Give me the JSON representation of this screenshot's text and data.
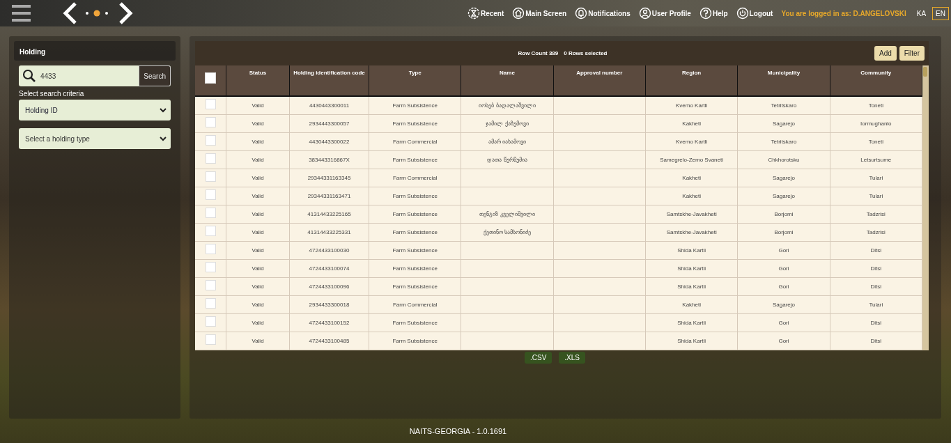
{
  "top_bar": {
    "nav": [
      {
        "kind": "recent",
        "label": "Recent"
      },
      {
        "kind": "home",
        "label": "Main Screen"
      },
      {
        "kind": "bell",
        "label": "Notifications"
      },
      {
        "kind": "user",
        "label": "User Profile"
      },
      {
        "kind": "help",
        "label": "Help"
      },
      {
        "kind": "power",
        "label": "Logout"
      }
    ],
    "login_text": "You are logged in as: D.ANGELOVSKI",
    "languages": [
      {
        "label": "KA",
        "selected": false
      },
      {
        "label": "EN",
        "selected": true
      }
    ]
  },
  "search_panel": {
    "title": "Holding",
    "search": {
      "value": "4433",
      "button": "Search"
    },
    "criteria_label": "Select search criteria",
    "criteria": "Holding ID",
    "holding_type": {
      "placeholder": "Select a holding type"
    }
  },
  "table": {
    "row_count": "Row Count 389",
    "selected_count": "0 Rows selected",
    "buttons": [
      "Add",
      "Filter"
    ],
    "header_checked": false,
    "columns": [
      "Status",
      "Holding identification code",
      "Type",
      "Name",
      "Approval number",
      "Region",
      "Municipality",
      "Community"
    ],
    "rows": [
      {
        "selected": false,
        "cells": [
          "Valid",
          "4430443300011",
          "Farm Subsistence",
          "იოსებ ბადალაშვილი",
          "",
          "Kvemo Kartli",
          "Tetritskaro",
          "Toneti"
        ]
      },
      {
        "selected": false,
        "cells": [
          "Valid",
          "2934443300057",
          "Farm Subsistence",
          "ჯამილ ქაზუმოვი",
          "",
          "Kakheti",
          "Sagarejo",
          "Iormughanlo"
        ]
      },
      {
        "selected": false,
        "cells": [
          "Valid",
          "4430443300022",
          "Farm Commercial",
          "ამარ იასამოვი",
          "",
          "Kvemo Kartli",
          "Tetritskaro",
          "Toneti"
        ]
      },
      {
        "selected": false,
        "cells": [
          "Valid",
          "383443316867X",
          "Farm Subsistence",
          "დათა წურწუმია",
          "",
          "Samegrelo-Zemo Svaneti",
          "Chkhorotsku",
          "Letsurtsume"
        ]
      },
      {
        "selected": false,
        "cells": [
          "Valid",
          "29344331163345",
          "Farm Commercial",
          "",
          "",
          "Kakheti",
          "Sagarejo",
          "Tulari"
        ]
      },
      {
        "selected": false,
        "cells": [
          "Valid",
          "29344331163471",
          "Farm Subsistence",
          "",
          "",
          "Kakheti",
          "Sagarejo",
          "Tulari"
        ]
      },
      {
        "selected": false,
        "cells": [
          "Valid",
          "41314433225165",
          "Farm Subsistence",
          "თენგიზ კველიშვილი",
          "",
          "Samtskhe-Javakheti",
          "Borjomi",
          "Tadzrisi"
        ]
      },
      {
        "selected": false,
        "cells": [
          "Valid",
          "41314433225331",
          "Farm Subsistence",
          "ქეთინო სამსონიძე",
          "",
          "Samtskhe-Javakheti",
          "Borjomi",
          "Tadzrisi"
        ]
      },
      {
        "selected": false,
        "cells": [
          "Valid",
          "4724433100030",
          "Farm Subsistence",
          "",
          "",
          "Shida Kartli",
          "Gori",
          "Ditsi"
        ]
      },
      {
        "selected": false,
        "cells": [
          "Valid",
          "4724433100074",
          "Farm Subsistence",
          "",
          "",
          "Shida Kartli",
          "Gori",
          "Ditsi"
        ]
      },
      {
        "selected": false,
        "cells": [
          "Valid",
          "4724433100096",
          "Farm Subsistence",
          "",
          "",
          "Shida Kartli",
          "Gori",
          "Ditsi"
        ]
      },
      {
        "selected": false,
        "cells": [
          "Valid",
          "2934433300018",
          "Farm Commercial",
          "",
          "",
          "Kakheti",
          "Sagarejo",
          "Tulari"
        ]
      },
      {
        "selected": false,
        "cells": [
          "Valid",
          "4724433100152",
          "Farm Subsistence",
          "",
          "",
          "Shida Kartli",
          "Gori",
          "Ditsi"
        ]
      },
      {
        "selected": false,
        "cells": [
          "Valid",
          "4724433100485",
          "Farm Subsistence",
          "",
          "",
          "Shida Kartli",
          "Gori",
          "Ditsi"
        ]
      }
    ],
    "exports": [
      ".CSV",
      ".XLS"
    ]
  },
  "footer": "NAITS-GEORGIA - 1.0.1691"
}
